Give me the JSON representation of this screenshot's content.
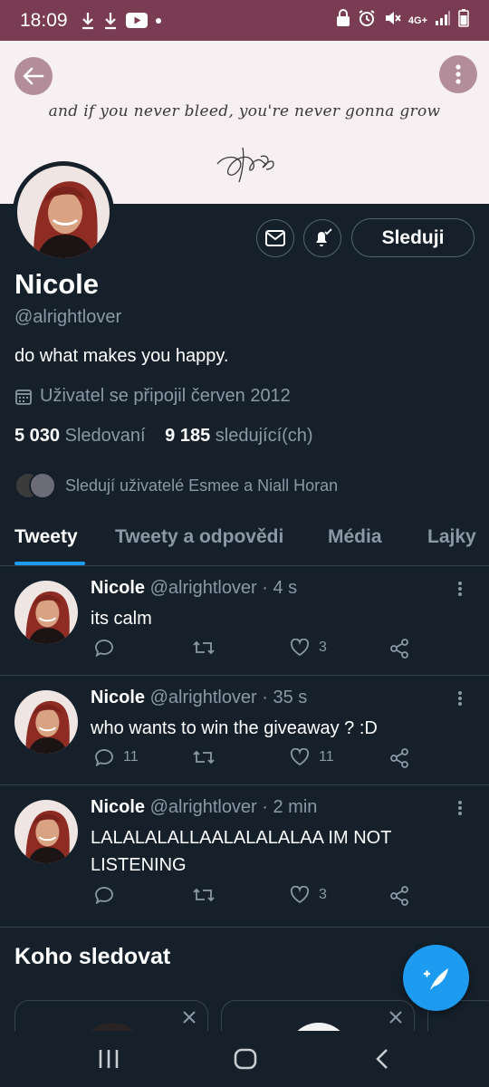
{
  "status_bar": {
    "time": "18:09",
    "network": "4G+"
  },
  "banner": {
    "quote": "and if you never bleed, you're never gonna grow"
  },
  "profile": {
    "name": "Nicole",
    "handle": "@alrightlover",
    "bio": "do what makes you happy.",
    "joined": "Uživatel se připojil červen 2012",
    "following_count": "5 030",
    "following_label": "Sledovaní",
    "followers_count": "9 185",
    "followers_label": "sledující(ch)",
    "followed_by": "Sledují uživatelé Esmee a Niall Horan",
    "follow_button": "Sleduji"
  },
  "tabs": [
    {
      "label": "Tweety",
      "active": true
    },
    {
      "label": "Tweety a odpovědi",
      "active": false
    },
    {
      "label": "Média",
      "active": false
    },
    {
      "label": "Lajky",
      "active": false
    }
  ],
  "tweets": [
    {
      "name": "Nicole",
      "handle": "@alrightlover",
      "time": "· 4 s",
      "text": "its calm",
      "replies": "",
      "retweets": "",
      "likes": "3"
    },
    {
      "name": "Nicole",
      "handle": "@alrightlover",
      "time": "· 35 s",
      "text": "who wants to win the giveaway ? :D",
      "replies": "11",
      "retweets": "",
      "likes": "11"
    },
    {
      "name": "Nicole",
      "handle": "@alrightlover",
      "time": "· 2 min",
      "text": "LALALALALLAALALALALAA IM NOT LISTENING",
      "replies": "",
      "retweets": "",
      "likes": "3"
    }
  ],
  "who_to_follow": {
    "title": "Koho sledovat"
  },
  "colors": {
    "background": "#15202b",
    "status_bar": "#7a3c52",
    "accent": "#1d9bf0",
    "secondary_text": "#8b98a5",
    "border": "#38444d"
  }
}
